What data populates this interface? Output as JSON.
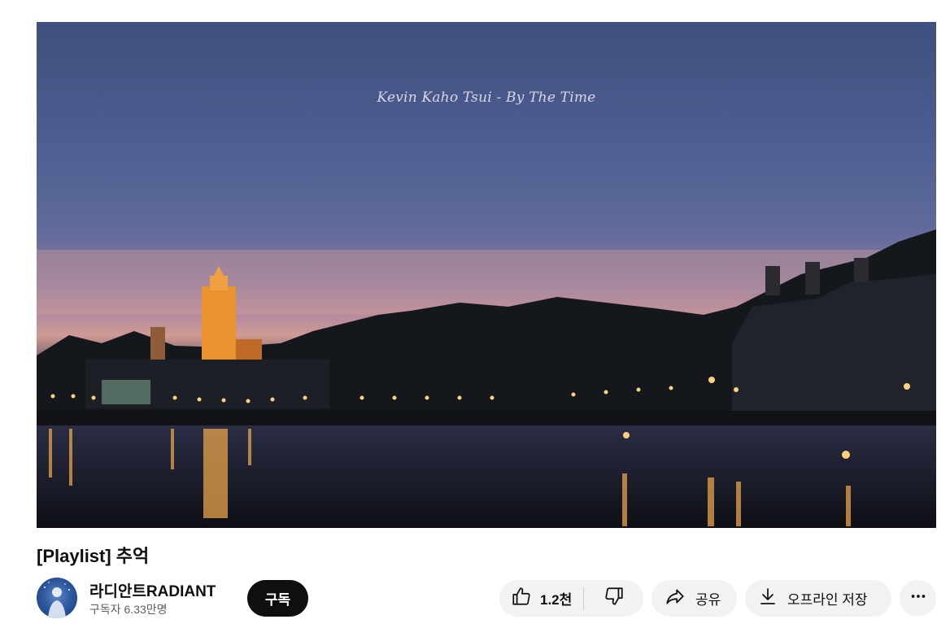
{
  "video": {
    "overlay_text": "Kevin Kaho Tsui - By The Time"
  },
  "title": "[Playlist] 추억",
  "channel": {
    "name": "라디안트RADIANT",
    "subscribers": "구독자 6.33만명"
  },
  "actions": {
    "subscribe_label": "구독",
    "like_count": "1.2천",
    "share_label": "공유",
    "download_label": "오프라인 저장"
  },
  "icons": [
    "thumbs-up-icon",
    "thumbs-down-icon",
    "share-arrow-icon",
    "download-icon",
    "more-dots-icon"
  ],
  "colors": {
    "subscribe_bg": "#0f0f0f",
    "pill_bg": "#f2f2f2",
    "secondary_text": "#606060"
  }
}
